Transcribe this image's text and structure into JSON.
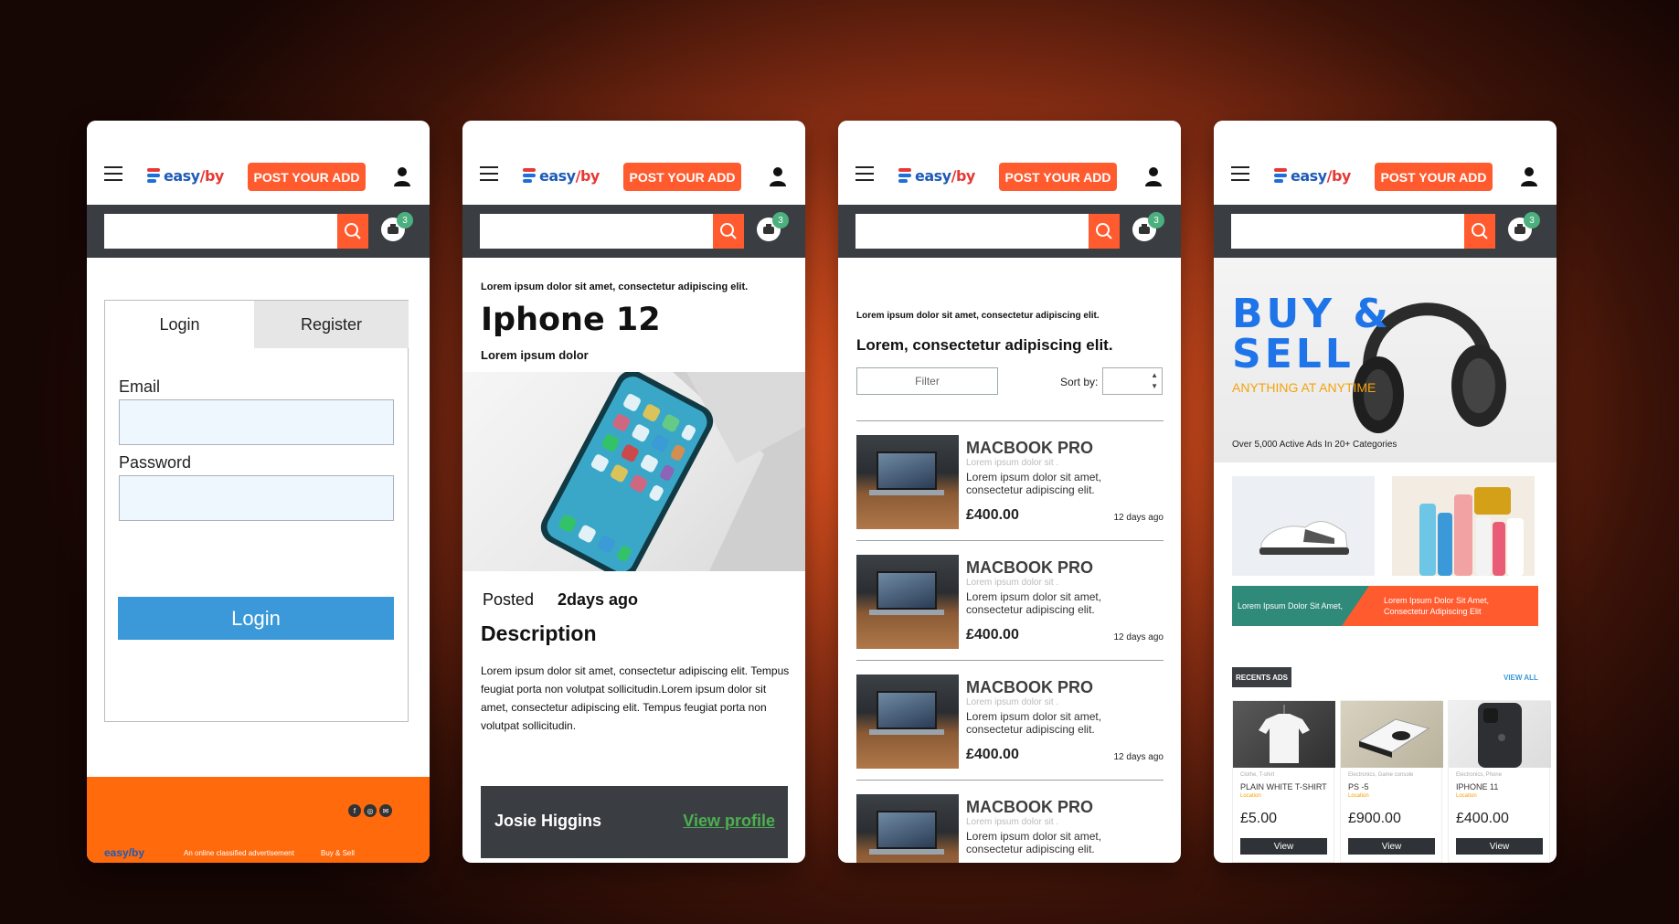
{
  "header": {
    "logo_text_a": "easy",
    "logo_text_b": "/by",
    "post_button": "POST YOUR ADD",
    "cart_count": "3"
  },
  "login_screen": {
    "tabs": [
      "Login",
      "Register"
    ],
    "email_label": "Email",
    "password_label": "Password",
    "email_value": "",
    "password_value": "",
    "login_button": "Login",
    "footer": {
      "logo": "easy/by",
      "tagline": "An online classified advertisement",
      "brand": "Buy & Sell",
      "social_icons": [
        "facebook-icon",
        "instagram-icon",
        "mail-icon"
      ]
    }
  },
  "product_screen": {
    "intro": "Lorem ipsum dolor sit amet, consectetur adipiscing elit.",
    "title": "Iphone 12",
    "subtitle": "Lorem ipsum dolor",
    "posted_label": "Posted",
    "posted_value": "2days ago",
    "description_heading": "Description",
    "description": "Lorem ipsum dolor sit amet, consectetur adipiscing elit. Tempus feugiat porta non volutpat sollicitudin.Lorem ipsum dolor sit amet, consectetur adipiscing elit. Tempus feugiat porta non volutpat sollicitudin.",
    "seller_name": "Josie Higgins",
    "view_profile": "View profile"
  },
  "listing_screen": {
    "intro": "Lorem ipsum dolor sit amet, consectetur adipiscing elit.",
    "title": "Lorem, consectetur adipiscing elit.",
    "filter_label": "Filter",
    "sort_label": "Sort by:",
    "items": [
      {
        "name": "MACBOOK PRO",
        "sub": "Lorem ipsum dolor sit .",
        "desc": "Lorem ipsum dolor sit amet, consectetur adipiscing elit.",
        "price": "£400.00",
        "date": "12 days ago"
      },
      {
        "name": "MACBOOK PRO",
        "sub": "Lorem ipsum dolor sit .",
        "desc": "Lorem ipsum dolor sit amet, consectetur adipiscing elit.",
        "price": "£400.00",
        "date": "12 days ago"
      },
      {
        "name": "MACBOOK PRO",
        "sub": "Lorem ipsum dolor sit .",
        "desc": "Lorem ipsum dolor sit amet, consectetur adipiscing elit.",
        "price": "£400.00",
        "date": "12 days ago"
      },
      {
        "name": "MACBOOK PRO",
        "sub": "Lorem ipsum dolor sit .",
        "desc": "Lorem ipsum dolor sit amet, consectetur adipiscing elit.",
        "price": "",
        "date": ""
      }
    ]
  },
  "home_screen": {
    "hero_title_1": "BUY &",
    "hero_title_2": "SELL",
    "hero_tagline": "ANYTHING AT ANYTIME",
    "hero_meta": "Over 5,000  Active Ads In 20+ Categories",
    "banner_left": "Lorem Ipsum Dolor Sit Amet,",
    "banner_right": "Lorem Ipsum Dolor Sit Amet, Consectetur Adipiscing Elit",
    "recent_label": "RECENTS ADS",
    "view_all": "VIEW ALL",
    "cards": [
      {
        "category": "Clothe, T-shirt",
        "name": "PLAIN WHITE T-SHIRT",
        "location": "Location",
        "price": "£5.00",
        "button": "View"
      },
      {
        "category": "Electronics, Game console",
        "name": "PS -5",
        "location": "Location",
        "price": "£900.00",
        "button": "View"
      },
      {
        "category": "Electronics, Phone",
        "name": "IPHONE 11",
        "location": "Location",
        "price": "£400.00",
        "button": "View"
      }
    ]
  },
  "colors": {
    "accent": "#ff5b2e",
    "dark_bar": "#3a3e42",
    "primary_blue": "#3b99d9",
    "footer_orange": "#ff6a0d",
    "badge_green": "#4caf7e",
    "hero_blue": "#1e74e8",
    "hero_tag_yellow": "#f4a20a"
  }
}
